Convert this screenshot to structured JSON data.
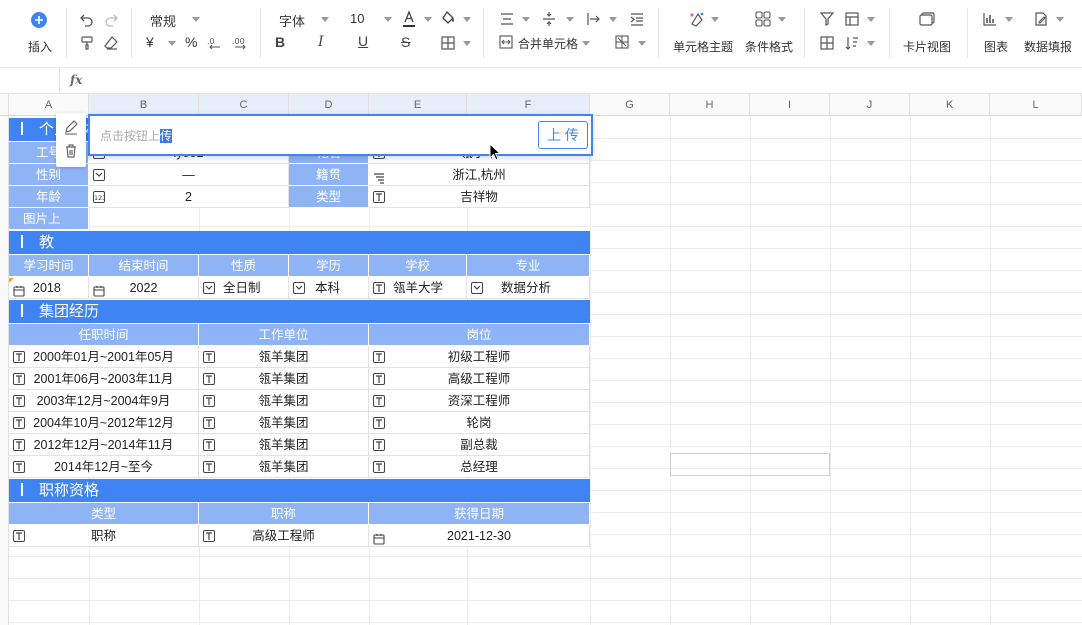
{
  "toolbar": {
    "insert_label": "插入",
    "number_format": "常规",
    "font_name": "字体",
    "font_size": "10",
    "merge_label": "合并单元格",
    "cell_theme_label": "单元格主题",
    "cond_format_label": "条件格式",
    "card_view_label": "卡片视图",
    "chart_label": "图表",
    "data_fill_label": "数据填报",
    "currency_glyph": "¥",
    "percent_glyph": "%",
    "text_color": "#333333",
    "accent": "#3f84f2"
  },
  "formula_bar": {
    "fx": "fx"
  },
  "columns": [
    "A",
    "B",
    "C",
    "D",
    "E",
    "F",
    "G",
    "H",
    "I",
    "J",
    "K",
    "L"
  ],
  "sections": {
    "personal": "个人基本信息",
    "education": "教",
    "group": "集团经历",
    "title": "职称资格"
  },
  "personal": {
    "emp_no_label": "工号",
    "emp_no": "ly001",
    "flower_label": "花名",
    "flower": "瓴小羊",
    "gender_label": "性别",
    "gender": "—",
    "origin_label": "籍贯",
    "origin": "浙江,杭州",
    "age_label": "年龄",
    "age": "2",
    "type_label": "类型",
    "type": "吉祥物",
    "photo_label": "图片上"
  },
  "upload": {
    "placeholder_prefix": "点击按钮上",
    "placeholder_selected": "传",
    "button": "上 传"
  },
  "education": {
    "headers": [
      "学习时间",
      "结束时间",
      "性质",
      "学历",
      "学校",
      "专业"
    ],
    "row": [
      "2018",
      "2022",
      "全日制",
      "本科",
      "瓴羊大学",
      "数据分析"
    ]
  },
  "group": {
    "headers": [
      "任职时间",
      "工作单位",
      "岗位"
    ],
    "rows": [
      [
        "2000年01月~2001年05月",
        "瓴羊集团",
        "初级工程师"
      ],
      [
        "2001年06月~2003年11月",
        "瓴羊集团",
        "高级工程师"
      ],
      [
        "2003年12月~2004年9月",
        "瓴羊集团",
        "资深工程师"
      ],
      [
        "2004年10月~2012年12月",
        "瓴羊集团",
        "轮岗"
      ],
      [
        "2012年12月~2014年11月",
        "瓴羊集团",
        "副总裁"
      ],
      [
        "2014年12月~至今",
        "瓴羊集团",
        "总经理"
      ]
    ]
  },
  "title": {
    "headers": [
      "类型",
      "职称",
      "获得日期"
    ],
    "row": [
      "职称",
      "高级工程师",
      "2021-12-30"
    ]
  }
}
